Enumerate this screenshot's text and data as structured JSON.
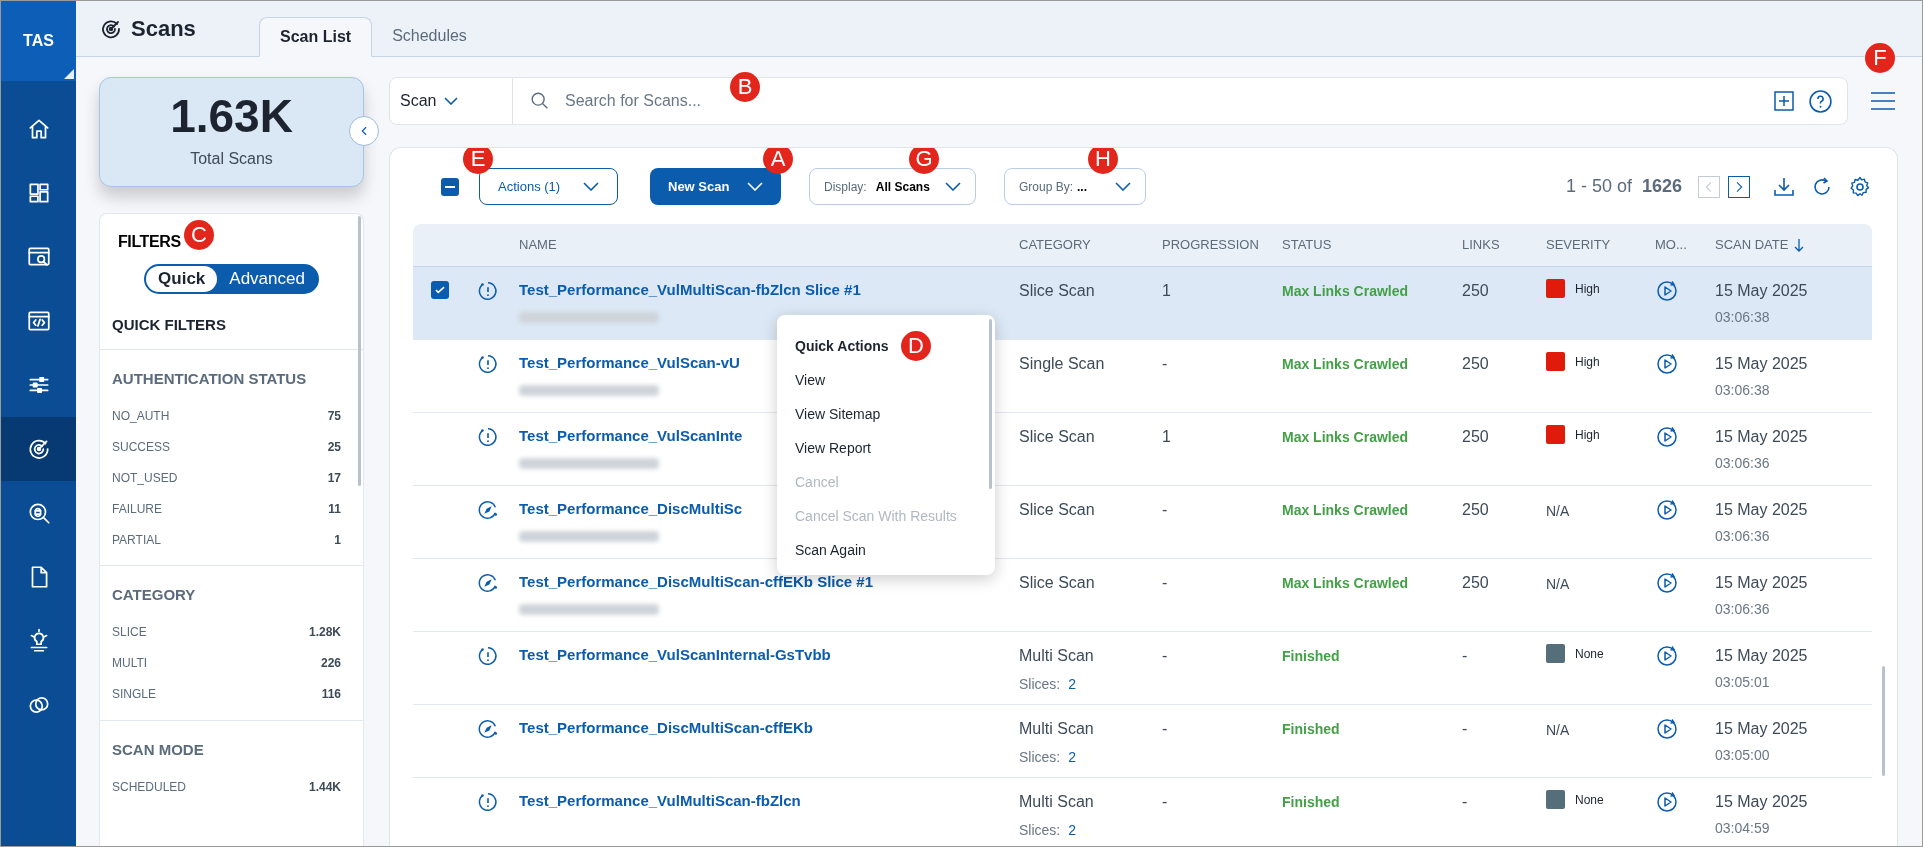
{
  "app": {
    "badge": "TAS"
  },
  "nav": [
    {
      "kind": "home",
      "selected": false
    },
    {
      "kind": "dashboard",
      "selected": false
    },
    {
      "kind": "search-window",
      "selected": false
    },
    {
      "kind": "code-window",
      "selected": false
    },
    {
      "kind": "sliders",
      "selected": false
    },
    {
      "kind": "radar",
      "selected": true
    },
    {
      "kind": "bug-search",
      "selected": false
    },
    {
      "kind": "document",
      "selected": false
    },
    {
      "kind": "lightbulb",
      "selected": false
    },
    {
      "kind": "link",
      "selected": false
    }
  ],
  "page": {
    "title": "Scans"
  },
  "tabs": [
    {
      "label": "Scan List",
      "selected": true
    },
    {
      "label": "Schedules",
      "selected": false
    }
  ],
  "summary": {
    "value": "1.63K",
    "label": "Total Scans"
  },
  "filters": {
    "title": "FILTERS",
    "callout": "C",
    "modes": [
      {
        "label": "Quick",
        "selected": true
      },
      {
        "label": "Advanced",
        "selected": false
      }
    ],
    "heading": "QUICK FILTERS",
    "sections": [
      {
        "title": "AUTHENTICATION STATUS",
        "items": [
          {
            "label": "NO_AUTH",
            "count": "75"
          },
          {
            "label": "SUCCESS",
            "count": "25"
          },
          {
            "label": "NOT_USED",
            "count": "17"
          },
          {
            "label": "FAILURE",
            "count": "11"
          },
          {
            "label": "PARTIAL",
            "count": "1"
          }
        ]
      },
      {
        "title": "CATEGORY",
        "items": [
          {
            "label": "SLICE",
            "count": "1.28K"
          },
          {
            "label": "MULTI",
            "count": "226"
          },
          {
            "label": "SINGLE",
            "count": "116"
          }
        ]
      },
      {
        "title": "SCAN MODE",
        "items": [
          {
            "label": "SCHEDULED",
            "count": "1.44K"
          }
        ]
      }
    ]
  },
  "search": {
    "scope": "Scan",
    "placeholder": "Search for Scans...",
    "callout": "B"
  },
  "menu_button": {
    "callout": "F"
  },
  "toolbar": {
    "select_all": {
      "kind": "partial"
    },
    "actions": {
      "label": "Actions (1)",
      "callout": "E"
    },
    "new_scan": {
      "label": "New Scan",
      "callout": "A"
    },
    "display": {
      "label": "Display:",
      "value": "All Scans",
      "callout": "G"
    },
    "group_by": {
      "label": "Group By:",
      "value": "...",
      "callout": "H"
    },
    "range": "1 - 50 of",
    "total": "1626",
    "prev_disabled": true,
    "next_disabled": false
  },
  "table": {
    "columns": [
      {
        "label": "NAME"
      },
      {
        "label": "CATEGORY"
      },
      {
        "label": "PROGRESSION"
      },
      {
        "label": "STATUS"
      },
      {
        "label": "LINKS"
      },
      {
        "label": "SEVERITY"
      },
      {
        "label": "MO..."
      },
      {
        "label": "SCAN DATE",
        "sorted": true
      }
    ],
    "rows": [
      {
        "selected": true,
        "kind": "vul",
        "name": "Test_Performance_VulMultiScan-fbZlcn Slice #1",
        "url_blurred": true,
        "category": "Slice Scan",
        "progression": "1",
        "status": "Max Links Crawled",
        "links": "250",
        "severity": {
          "label": "High",
          "color": "#e01b0b"
        },
        "date": "15 May 2025",
        "time": "03:06:38"
      },
      {
        "selected": false,
        "kind": "vul",
        "name": "Test_Performance_VulScan-vU",
        "url_blurred": true,
        "category": "Single Scan",
        "progression": "-",
        "status": "Max Links Crawled",
        "links": "250",
        "severity": {
          "label": "High",
          "color": "#e01b0b"
        },
        "date": "15 May 2025",
        "time": "03:06:38"
      },
      {
        "selected": false,
        "kind": "vul",
        "name": "Test_Performance_VulScanInte",
        "url_blurred": true,
        "category": "Slice Scan",
        "progression": "1",
        "status": "Max Links Crawled",
        "links": "250",
        "severity": {
          "label": "High",
          "color": "#e01b0b"
        },
        "date": "15 May 2025",
        "time": "03:06:36"
      },
      {
        "selected": false,
        "kind": "disc",
        "name": "Test_Performance_DiscMultiSc",
        "url_blurred": true,
        "category": "Slice Scan",
        "progression": "-",
        "status": "Max Links Crawled",
        "links": "250",
        "severity": {
          "label": "N/A"
        },
        "date": "15 May 2025",
        "time": "03:06:36"
      },
      {
        "selected": false,
        "kind": "disc",
        "name": "Test_Performance_DiscMultiScan-cffEKb Slice #1",
        "url_blurred": true,
        "category": "Slice Scan",
        "progression": "-",
        "status": "Max Links Crawled",
        "links": "250",
        "severity": {
          "label": "N/A"
        },
        "date": "15 May 2025",
        "time": "03:06:36"
      },
      {
        "selected": false,
        "kind": "vul",
        "name": "Test_Performance_VulScanInternal-GsTvbb",
        "url_blurred": false,
        "category": "Multi Scan",
        "slices_label": "Slices:",
        "slices": "2",
        "progression": "-",
        "status": "Finished",
        "links": "-",
        "severity": {
          "label": "None",
          "color": "#546e7a"
        },
        "date": "15 May 2025",
        "time": "03:05:01"
      },
      {
        "selected": false,
        "kind": "disc",
        "name": "Test_Performance_DiscMultiScan-cffEKb",
        "url_blurred": false,
        "category": "Multi Scan",
        "slices_label": "Slices:",
        "slices": "2",
        "progression": "-",
        "status": "Finished",
        "links": "-",
        "severity": {
          "label": "N/A"
        },
        "date": "15 May 2025",
        "time": "03:05:00"
      },
      {
        "selected": false,
        "kind": "vul",
        "name": "Test_Performance_VulMultiScan-fbZlcn",
        "url_blurred": false,
        "category": "Multi Scan",
        "slices_label": "Slices:",
        "slices": "2",
        "progression": "-",
        "status": "Finished",
        "links": "-",
        "severity": {
          "label": "None",
          "color": "#546e7a"
        },
        "date": "15 May 2025",
        "time": "03:04:59"
      }
    ]
  },
  "quick_menu": {
    "title": "Quick Actions",
    "callout": "D",
    "items": [
      {
        "label": "View",
        "disabled": false
      },
      {
        "label": "View Sitemap",
        "disabled": false
      },
      {
        "label": "View Report",
        "disabled": false
      },
      {
        "label": "Cancel",
        "disabled": true
      },
      {
        "label": "Cancel Scan With Results",
        "disabled": true
      },
      {
        "label": "Scan Again",
        "disabled": false
      }
    ]
  }
}
